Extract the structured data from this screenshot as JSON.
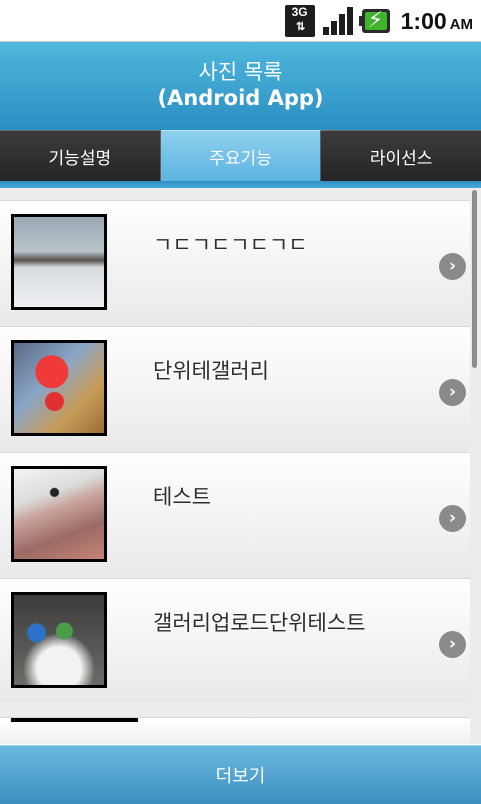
{
  "status_bar": {
    "network": "3G",
    "time": "1:00",
    "ampm": "AM",
    "icons": [
      "3g-data-icon",
      "signal-icon",
      "battery-charging-icon"
    ]
  },
  "header": {
    "title_line1": "사진 목록",
    "title_line2": "(Android App)"
  },
  "tabs": [
    {
      "label": "기능설명",
      "selected": false
    },
    {
      "label": "주요기능",
      "selected": true
    },
    {
      "label": "라이선스",
      "selected": false
    }
  ],
  "list": {
    "items": [
      {
        "label": "ㄱㄷㄱㄷㄱㄷㄱㄷ"
      },
      {
        "label": "단위테갤러리"
      },
      {
        "label": "테스트"
      },
      {
        "label": "갤러리업로드단위테스트"
      }
    ]
  },
  "footer": {
    "more_label": "더보기"
  },
  "colors": {
    "accent": "#3b9fd0",
    "tab_selected": "#7cc4e8",
    "tab_normal": "#2f2f2f"
  }
}
